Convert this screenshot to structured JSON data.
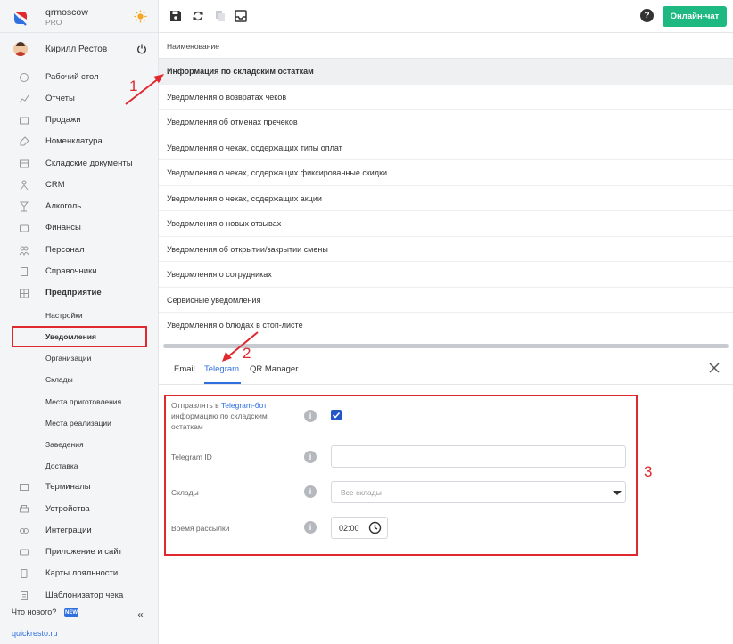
{
  "app": {
    "brand_name": "qrmoscow",
    "brand_plan": "PRO",
    "user_name": "Кирилл Рестов",
    "colors": {
      "accent": "#2f6fe0",
      "chat_button": "#1eb980",
      "annotation": "#e0292e"
    }
  },
  "sidebar": {
    "items": [
      {
        "label": "Рабочий стол",
        "icon": "home-icon"
      },
      {
        "label": "Отчеты",
        "icon": "chart-icon"
      },
      {
        "label": "Продажи",
        "icon": "cart-icon"
      },
      {
        "label": "Номенклатура",
        "icon": "tag-icon"
      },
      {
        "label": "Складские документы",
        "icon": "box-icon"
      },
      {
        "label": "CRM",
        "icon": "people-icon"
      },
      {
        "label": "Алкоголь",
        "icon": "glass-icon"
      },
      {
        "label": "Финансы",
        "icon": "wallet-icon"
      },
      {
        "label": "Персонал",
        "icon": "staff-icon"
      },
      {
        "label": "Справочники",
        "icon": "book-icon"
      },
      {
        "label": "Предприятие",
        "icon": "building-icon"
      }
    ],
    "sub_items": [
      {
        "label": "Настройки"
      },
      {
        "label": "Уведомления"
      },
      {
        "label": "Организации"
      },
      {
        "label": "Склады"
      },
      {
        "label": "Места приготовления"
      },
      {
        "label": "Места реализации"
      },
      {
        "label": "Заведения"
      },
      {
        "label": "Доставка"
      }
    ],
    "items_bottom": [
      {
        "label": "Терминалы",
        "icon": "terminal-icon"
      },
      {
        "label": "Устройства",
        "icon": "printer-icon"
      },
      {
        "label": "Интеграции",
        "icon": "link-icon"
      },
      {
        "label": "Приложение и сайт",
        "icon": "phone-icon"
      },
      {
        "label": "Карты лояльности",
        "icon": "card-icon"
      },
      {
        "label": "Шаблонизатор чека",
        "icon": "receipt-icon"
      }
    ],
    "whats_new": "Что нового?",
    "new_badge": "NEW",
    "site": "quickresto.ru"
  },
  "toolbar": {
    "online_chat": "Онлайн-чат",
    "help": "?"
  },
  "list": {
    "column_header": "Наименование",
    "rows": [
      "Информация по складским остаткам",
      "Уведомления о возвратах чеков",
      "Уведомления об отменах пречеков",
      "Уведомления о чеках, содержащих типы оплат",
      "Уведомления о чеках, содержащих фиксированные скидки",
      "Уведомления о чеках, содержащих акции",
      "Уведомления о новых отзывах",
      "Уведомления об открытии/закрытии смены",
      "Уведомления о сотрудниках",
      "Сервисные уведомления",
      "Уведомления о блюдах в стоп-листе"
    ]
  },
  "tabs": [
    "Email",
    "Telegram",
    "QR Manager"
  ],
  "form": {
    "send_label_prefix": "Отправлять в ",
    "send_label_link": "Telegram-бот",
    "send_label_suffix": "информацию по складским остаткам",
    "send_checked": true,
    "telegram_id_label": "Telegram ID",
    "telegram_id_value": "",
    "warehouses_label": "Склады",
    "warehouses_value": "Все склады",
    "time_label": "Время рассылки",
    "time_value": "02:00"
  },
  "annotations": [
    "1",
    "2",
    "3"
  ]
}
